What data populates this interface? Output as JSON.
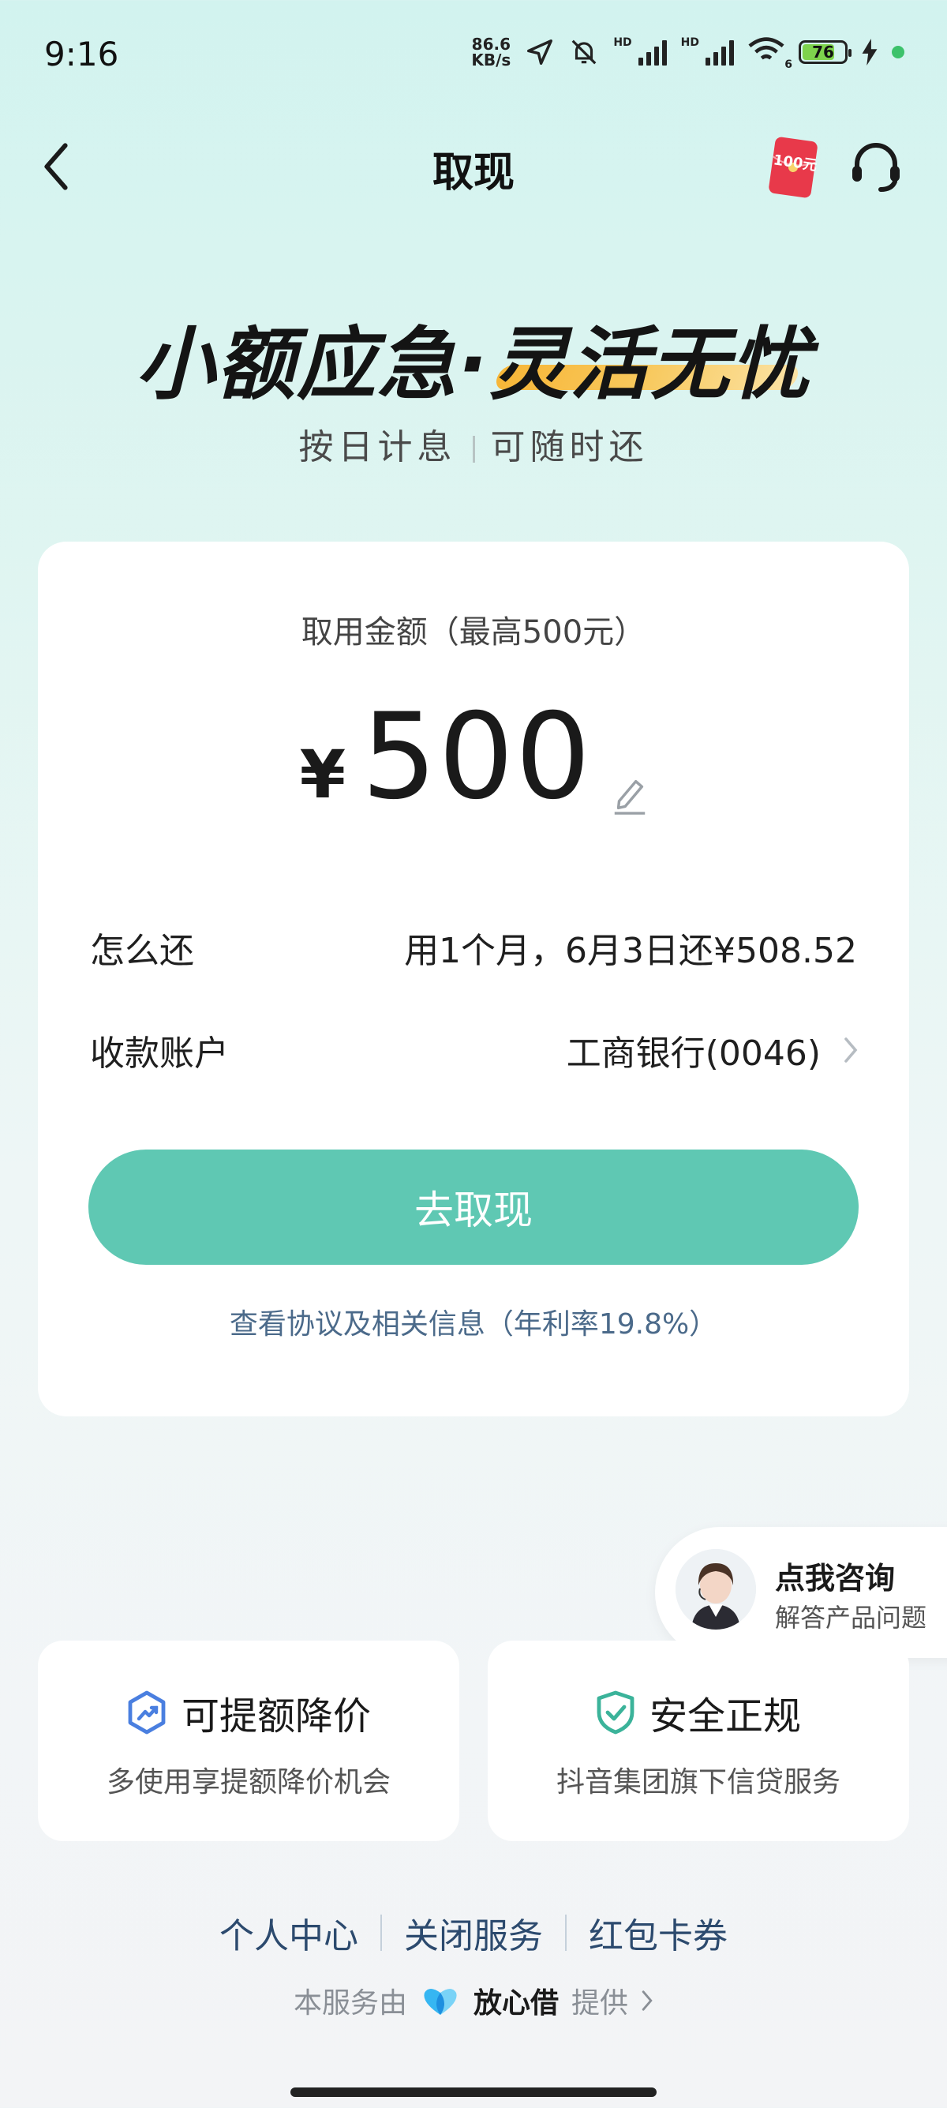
{
  "status_bar": {
    "time": "9:16",
    "net_speed_value": "86.6",
    "net_speed_unit": "KB/s",
    "signal_1_tag": "HD",
    "signal_2_tag": "HD",
    "wifi_badge": "6",
    "battery": "76",
    "icons": [
      "location-icon",
      "mute-bell-icon",
      "signal-icon",
      "wifi-icon",
      "battery-icon",
      "charging-icon"
    ]
  },
  "nav": {
    "title": "取现",
    "red_packet_label": "100元",
    "icons": [
      "back-icon",
      "red-packet-icon",
      "customer-service-icon"
    ]
  },
  "hero": {
    "title_part1": "小额应急·",
    "title_part2": "灵活无忧",
    "sub_left": "按日计息",
    "sub_right": "可随时还"
  },
  "withdraw": {
    "amount_label": "取用金额（最高500元）",
    "currency": "¥",
    "amount": "500",
    "repay_label": "怎么还",
    "repay_value": "用1个月，6月3日还¥508.52",
    "account_label": "收款账户",
    "account_value": "工商银行(0046)",
    "cta": "去取现",
    "agreement": "查看协议及相关信息（年利率19.8%）"
  },
  "consult": {
    "title": "点我咨询",
    "subtitle": "解答产品问题"
  },
  "features": [
    {
      "title": "可提额降价",
      "subtitle": "多使用享提额降价机会",
      "icon": "trend-up-shield-icon"
    },
    {
      "title": "安全正规",
      "subtitle": "抖音集团旗下信贷服务",
      "icon": "check-shield-icon"
    }
  ],
  "footer": {
    "links": [
      "个人中心",
      "关闭服务",
      "红包卡券"
    ],
    "provider_prefix": "本服务由",
    "provider_brand": "放心借",
    "provider_suffix": "提供"
  },
  "colors": {
    "accent": "#5fc8b3",
    "link": "#4b6a8a",
    "footer_link": "#2c4a6e",
    "hero_highlight": "#f7b637",
    "red_packet": "#e8394a"
  }
}
